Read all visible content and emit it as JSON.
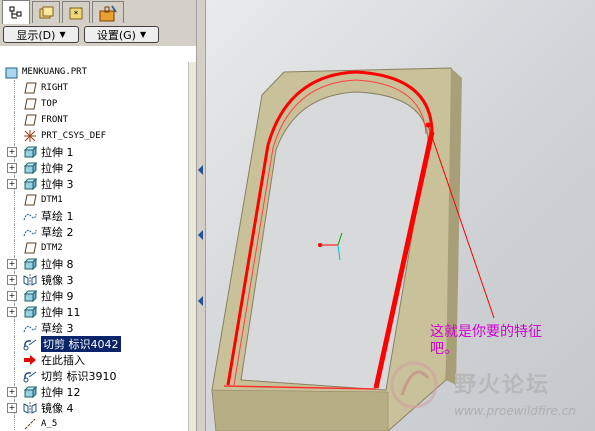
{
  "toolbar": {
    "show_label": "显示(D)",
    "settings_label": "设置(G)"
  },
  "tabs": [
    {
      "name": "model-tree-tab",
      "icon": "model-tree-icon"
    },
    {
      "name": "folder-browser-tab",
      "icon": "folder-icon"
    },
    {
      "name": "favorites-tab",
      "icon": "favorites-icon"
    },
    {
      "name": "tools-tab",
      "icon": "toolbox-icon"
    }
  ],
  "tree": {
    "root": "MENKUANG.PRT",
    "items": [
      {
        "label": "RIGHT",
        "icon": "datum-plane-icon",
        "expandable": false
      },
      {
        "label": "TOP",
        "icon": "datum-plane-icon",
        "expandable": false
      },
      {
        "label": "FRONT",
        "icon": "datum-plane-icon",
        "expandable": false
      },
      {
        "label": "PRT_CSYS_DEF",
        "icon": "coordinate-system-icon",
        "expandable": false
      },
      {
        "label": "拉伸 1",
        "icon": "extrude-icon",
        "expandable": true
      },
      {
        "label": "拉伸 2",
        "icon": "extrude-icon",
        "expandable": true
      },
      {
        "label": "拉伸 3",
        "icon": "extrude-icon",
        "expandable": true
      },
      {
        "label": "DTM1",
        "icon": "datum-plane-icon",
        "expandable": false
      },
      {
        "label": "草绘 1",
        "icon": "sketch-icon",
        "expandable": false
      },
      {
        "label": "草绘 2",
        "icon": "sketch-icon",
        "expandable": false
      },
      {
        "label": "DTM2",
        "icon": "datum-plane-icon",
        "expandable": false
      },
      {
        "label": "拉伸 8",
        "icon": "extrude-icon",
        "expandable": true
      },
      {
        "label": "镜像 3",
        "icon": "mirror-icon",
        "expandable": true
      },
      {
        "label": "拉伸 9",
        "icon": "extrude-icon",
        "expandable": true
      },
      {
        "label": "拉伸 11",
        "icon": "extrude-icon",
        "expandable": true
      },
      {
        "label": "草绘 3",
        "icon": "sketch-icon",
        "expandable": false
      },
      {
        "label": "切剪 标识4042",
        "icon": "cut-icon",
        "expandable": false,
        "selected": true
      },
      {
        "label": "在此插入",
        "icon": "insert-here-arrow-icon",
        "expandable": false
      },
      {
        "label": "切剪 标识3910",
        "icon": "cut-icon",
        "expandable": false
      },
      {
        "label": "拉伸 12",
        "icon": "extrude-icon",
        "expandable": true
      },
      {
        "label": "镜像 4",
        "icon": "mirror-icon",
        "expandable": true
      },
      {
        "label": "A_5",
        "icon": "axis-icon",
        "expandable": false
      }
    ]
  },
  "viewport": {
    "annotation_line1": "这就是你要的特征",
    "annotation_line2": "吧。",
    "watermark_text": "野火论坛",
    "watermark_url": "www.proewildfire.cn",
    "annotation_color": "#d000d0",
    "highlight_color": "#ff0000",
    "model_color": "#c9c19a"
  }
}
